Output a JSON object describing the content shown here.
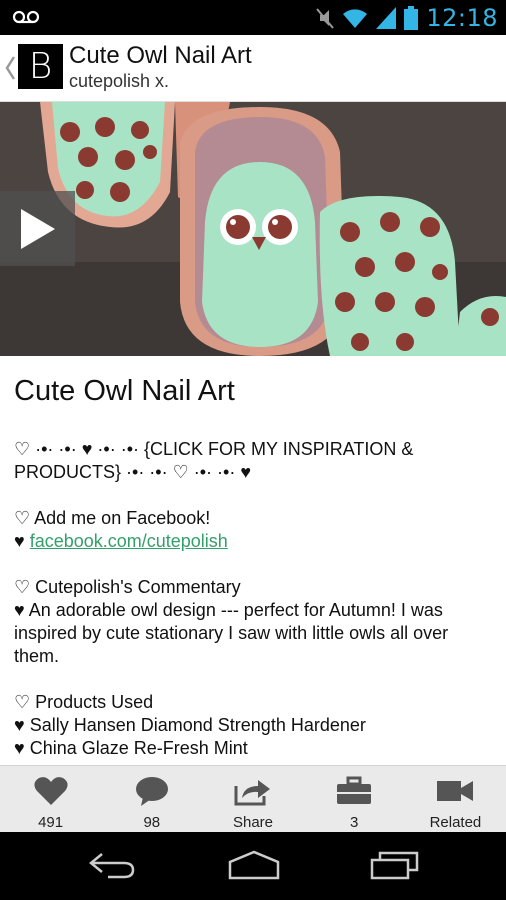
{
  "status_bar": {
    "time": "12:18",
    "icons": [
      "voicemail-icon",
      "mute-icon",
      "wifi-icon",
      "signal-icon",
      "battery-icon"
    ],
    "accent": "#33b5e5"
  },
  "header": {
    "logo_letter": "B",
    "title": "Cute Owl Nail Art",
    "subtitle": "cutepolish x."
  },
  "video": {
    "play_icon": "play-icon"
  },
  "post": {
    "title": "Cute Owl Nail Art",
    "inspiration_line": "♡ ·•· ·•· ♥ ·•· ·•· {CLICK FOR MY INSPIRATION & PRODUCTS} ·•· ·•· ♡ ·•· ·•· ♥",
    "facebook_heading": "♡ Add me on Facebook!",
    "facebook_bullet": "♥",
    "facebook_link": "facebook.com/cutepolish",
    "commentary_heading": "♡ Cutepolish's Commentary",
    "commentary_text": "♥ An adorable owl design --- perfect for Autumn! I was inspired by cute stationary I saw with little owls all over them.",
    "products_heading": "♡ Products Used",
    "product_1": "♥ Sally Hansen Diamond Strength Hardener",
    "product_2": "♥ China Glaze Re-Fresh Mint",
    "link_color": "#33a06a"
  },
  "actions": {
    "likes": "491",
    "comments": "98",
    "share": "Share",
    "collections": "3",
    "related": "Related"
  }
}
